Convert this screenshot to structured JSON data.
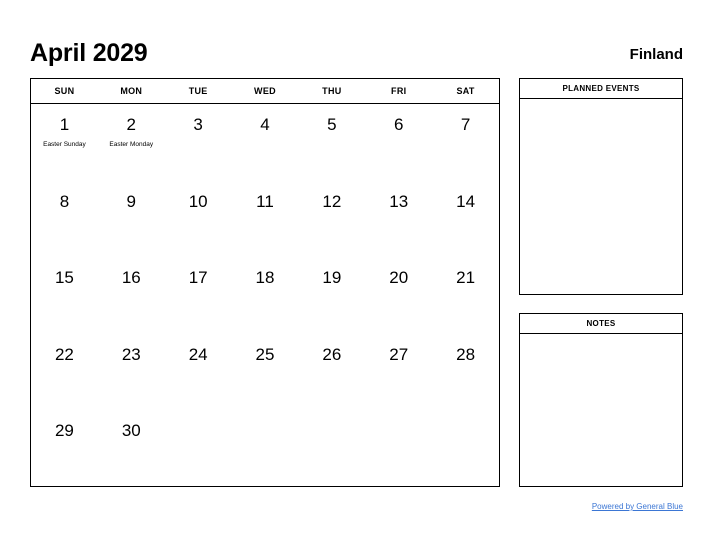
{
  "header": {
    "month_title": "April 2029",
    "region": "Finland"
  },
  "calendar": {
    "weekday_headers": [
      "SUN",
      "MON",
      "TUE",
      "WED",
      "THU",
      "FRI",
      "SAT"
    ],
    "weeks": [
      [
        {
          "day": "1",
          "event": "Easter Sunday"
        },
        {
          "day": "2",
          "event": "Easter Monday"
        },
        {
          "day": "3",
          "event": ""
        },
        {
          "day": "4",
          "event": ""
        },
        {
          "day": "5",
          "event": ""
        },
        {
          "day": "6",
          "event": ""
        },
        {
          "day": "7",
          "event": ""
        }
      ],
      [
        {
          "day": "8",
          "event": ""
        },
        {
          "day": "9",
          "event": ""
        },
        {
          "day": "10",
          "event": ""
        },
        {
          "day": "11",
          "event": ""
        },
        {
          "day": "12",
          "event": ""
        },
        {
          "day": "13",
          "event": ""
        },
        {
          "day": "14",
          "event": ""
        }
      ],
      [
        {
          "day": "15",
          "event": ""
        },
        {
          "day": "16",
          "event": ""
        },
        {
          "day": "17",
          "event": ""
        },
        {
          "day": "18",
          "event": ""
        },
        {
          "day": "19",
          "event": ""
        },
        {
          "day": "20",
          "event": ""
        },
        {
          "day": "21",
          "event": ""
        }
      ],
      [
        {
          "day": "22",
          "event": ""
        },
        {
          "day": "23",
          "event": ""
        },
        {
          "day": "24",
          "event": ""
        },
        {
          "day": "25",
          "event": ""
        },
        {
          "day": "26",
          "event": ""
        },
        {
          "day": "27",
          "event": ""
        },
        {
          "day": "28",
          "event": ""
        }
      ],
      [
        {
          "day": "29",
          "event": ""
        },
        {
          "day": "30",
          "event": ""
        },
        {
          "day": "",
          "event": ""
        },
        {
          "day": "",
          "event": ""
        },
        {
          "day": "",
          "event": ""
        },
        {
          "day": "",
          "event": ""
        },
        {
          "day": "",
          "event": ""
        }
      ]
    ]
  },
  "panels": {
    "planned_events": {
      "title": "PLANNED EVENTS",
      "content": ""
    },
    "notes": {
      "title": "NOTES",
      "content": ""
    }
  },
  "footer": {
    "link_label": "Powered by General Blue",
    "link_color": "#3b76d4"
  }
}
